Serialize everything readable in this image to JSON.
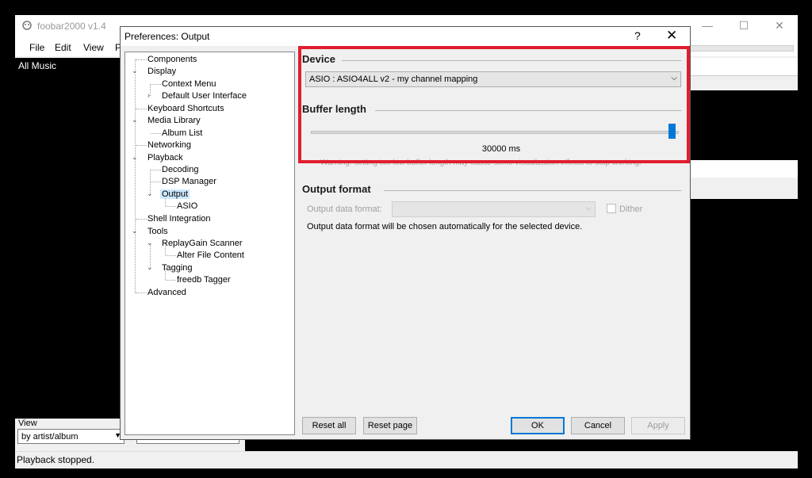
{
  "main_window": {
    "title": "foobar2000 v1.4",
    "menu": [
      "File",
      "Edit",
      "View",
      "P"
    ],
    "caption_buttons": {
      "minimize": "—",
      "maximize": "☐",
      "close": "✕"
    },
    "left_pane_label": "All Music",
    "view_label": "View",
    "view_value": "by artist/album",
    "status": "Playback stopped."
  },
  "dialog": {
    "title": "Preferences: Output",
    "help": "?",
    "close": "✕",
    "tree": [
      {
        "label": "Components",
        "level": 0
      },
      {
        "label": "Display",
        "level": 0,
        "expanded": true
      },
      {
        "label": "Context Menu",
        "level": 1
      },
      {
        "label": "Default User Interface",
        "level": 1,
        "collapsed": true
      },
      {
        "label": "Keyboard Shortcuts",
        "level": 0
      },
      {
        "label": "Media Library",
        "level": 0,
        "expanded": true
      },
      {
        "label": "Album List",
        "level": 1
      },
      {
        "label": "Networking",
        "level": 0
      },
      {
        "label": "Playback",
        "level": 0,
        "expanded": true
      },
      {
        "label": "Decoding",
        "level": 1
      },
      {
        "label": "DSP Manager",
        "level": 1
      },
      {
        "label": "Output",
        "level": 1,
        "expanded": true,
        "selected": true
      },
      {
        "label": "ASIO",
        "level": 2
      },
      {
        "label": "Shell Integration",
        "level": 0
      },
      {
        "label": "Tools",
        "level": 0,
        "expanded": true
      },
      {
        "label": "ReplayGain Scanner",
        "level": 1,
        "expanded": true
      },
      {
        "label": "Alter File Content",
        "level": 2
      },
      {
        "label": "Tagging",
        "level": 1,
        "expanded": true
      },
      {
        "label": "freedb Tagger",
        "level": 2
      },
      {
        "label": "Advanced",
        "level": 0
      }
    ],
    "device": {
      "title": "Device",
      "value": "ASIO : ASIO4ALL v2 - my channel mapping"
    },
    "buffer": {
      "title": "Buffer length",
      "value": "30000 ms",
      "level": 1.0,
      "warning": "Warning: setting too low buffer length may cause some visualization effects to stop working."
    },
    "output_format": {
      "title": "Output format",
      "label": "Output data format:",
      "dither_label": "Dither",
      "description": "Output data format will be chosen automatically for the selected device."
    },
    "buttons": {
      "reset_all": "Reset all",
      "reset_page": "Reset page",
      "ok": "OK",
      "cancel": "Cancel",
      "apply": "Apply"
    },
    "highlight_color": "#e01e2e",
    "accent_color": "#0078d7"
  }
}
